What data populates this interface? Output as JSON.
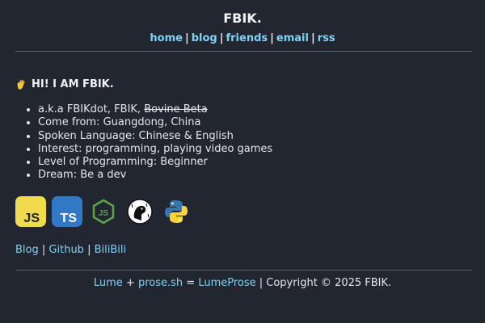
{
  "header": {
    "title": "FBIK.",
    "nav": [
      {
        "label": "home"
      },
      {
        "label": "blog"
      },
      {
        "label": "friends"
      },
      {
        "label": "email"
      },
      {
        "label": "rss"
      }
    ],
    "separator": "|"
  },
  "intro": {
    "heading": "HI! I AM FBIK.",
    "wave_icon": "waving-hand-icon",
    "facts": [
      {
        "prefix": "a.k.a FBIKdot, FBIK, ",
        "struck": "Bovine Beta"
      },
      {
        "text": "Come from: Guangdong, China"
      },
      {
        "text": "Spoken Language: Chinese & English"
      },
      {
        "text": "Interest: programming, playing video games"
      },
      {
        "text": "Level of Programming: Beginner"
      },
      {
        "text": "Dream: Be a dev"
      }
    ]
  },
  "tech_icons": [
    {
      "name": "javascript-icon",
      "label": "JS",
      "color": "#f0db4f"
    },
    {
      "name": "typescript-icon",
      "label": "TS",
      "color": "#3178c6"
    },
    {
      "name": "nodejs-icon",
      "label": "JS",
      "color": "#5fa04e"
    },
    {
      "name": "deno-icon",
      "color": "#ffffff"
    },
    {
      "name": "python-icon",
      "color": "#3776ab",
      "accent": "#ffd43b"
    }
  ],
  "social": {
    "links": [
      "Blog",
      "Github",
      "BiliBili"
    ],
    "separator": "|"
  },
  "footer": {
    "lume": "Lume",
    "plus": "+",
    "prose": "prose.sh",
    "equals": "=",
    "lumeprose": "LumeProse",
    "copyright": "| Copyright © 2025 FBIK."
  },
  "colors": {
    "background": "#222631",
    "link": "#7fd3f2",
    "text": "#e4e6eb",
    "divider": "#5b606d"
  }
}
